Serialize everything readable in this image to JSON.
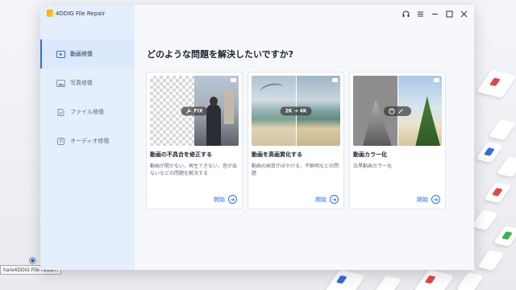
{
  "taskbar": {
    "tooltip": "hare4DDiG File Repair)"
  },
  "app": {
    "name": "4DDIG File Repair",
    "accent": "#2f6fe4"
  },
  "titlebar": {
    "icons": [
      "headset-icon",
      "menu-icon",
      "minimize-icon",
      "maximize-icon",
      "close-icon"
    ]
  },
  "sidebar": {
    "items": [
      {
        "label": "動画修復",
        "icon": "video-icon",
        "active": true
      },
      {
        "label": "写真修復",
        "icon": "photo-icon",
        "active": false
      },
      {
        "label": "ファイル修復",
        "icon": "file-icon",
        "active": false
      },
      {
        "label": "オーディオ修復",
        "icon": "audio-icon",
        "active": false
      }
    ]
  },
  "main": {
    "title": "どのような問題を解決したいですか?",
    "cards": [
      {
        "badge": "FIX",
        "title": "動画の不具合を修正する",
        "desc": "動画が開かない、再生できない、音が出ないなどの問題を解決する",
        "start": "開始"
      },
      {
        "badge": "2K → 4K",
        "title": "動画を高画質化する",
        "desc": "動画の画質がぼやける、不鮮明などの問題",
        "start": "開始"
      },
      {
        "badge": "",
        "title": "動画カラー化",
        "desc": "白黒動画カラー化",
        "start": "開始"
      }
    ]
  }
}
